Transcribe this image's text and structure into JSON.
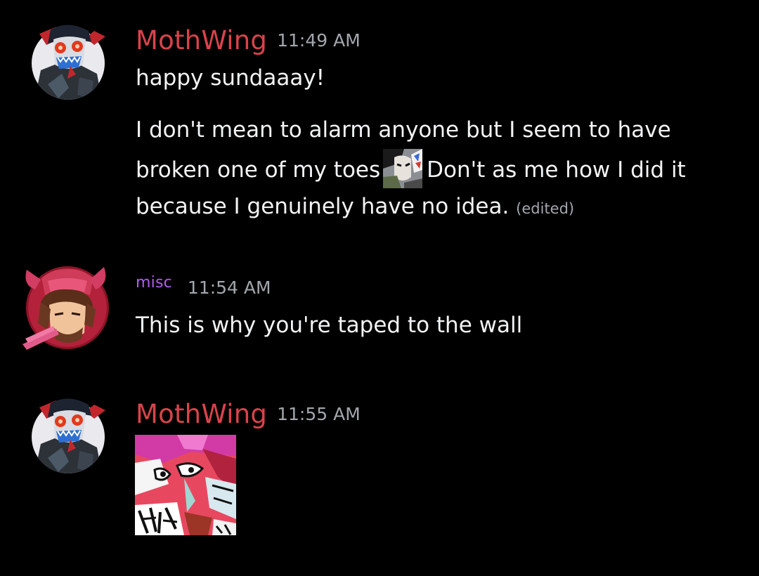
{
  "messages": [
    {
      "author": "MothWing",
      "time": "11:49 AM",
      "lines": [
        "happy sundaaay!",
        "I don't mean to alarm anyone but I seem to have",
        "broken one of my toes",
        "Don't as me how I did it",
        "because I genuinely have no idea."
      ],
      "edited": "(edited)"
    },
    {
      "author": "misc",
      "time": "11:54 AM",
      "text": "This is why you're taped to the wall"
    },
    {
      "author": "MothWing",
      "time": "11:55 AM",
      "attachment": "sticker-image"
    }
  ],
  "colors": {
    "background": "#000000",
    "mothwing_name": "#d9434a",
    "misc_name": "#b15cf0",
    "timestamp": "#a3a6ac",
    "message_text": "#f2f3f5"
  },
  "icons": {
    "mothwing_avatar": "moth-avatar-icon",
    "misc_avatar": "demon-avatar-icon",
    "custom_emoji": "custom-emoji-icon"
  }
}
